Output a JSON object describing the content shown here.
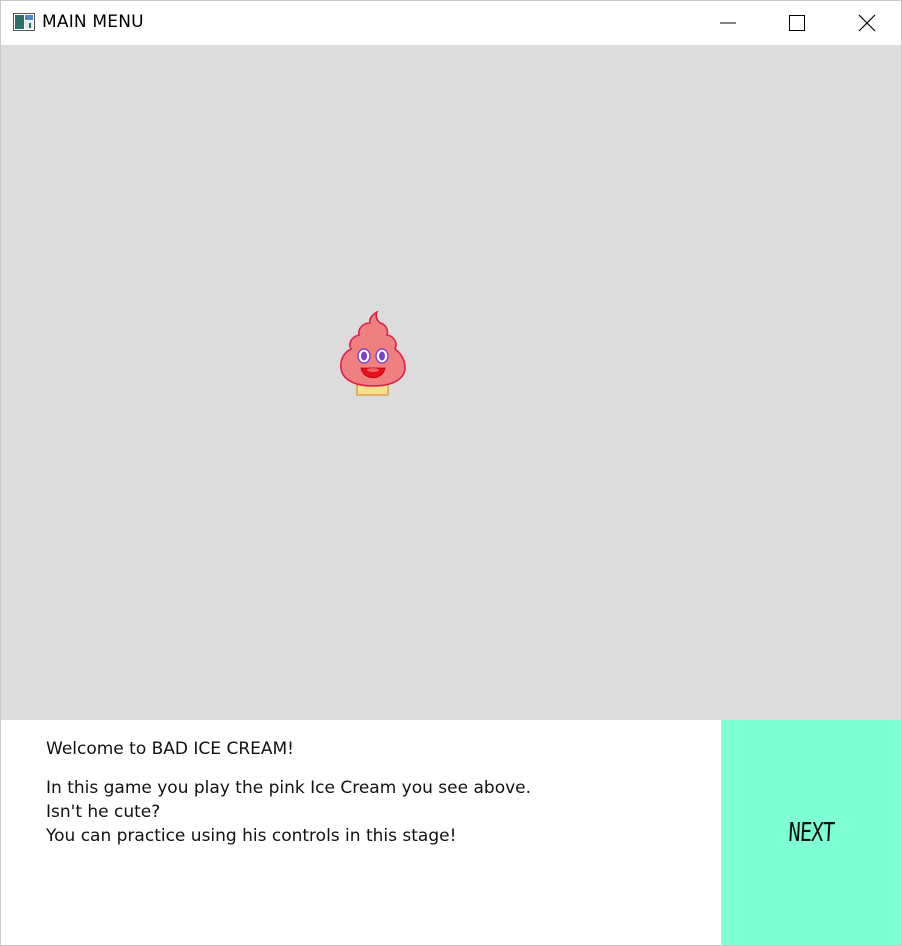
{
  "window": {
    "title": "MAIN MENU",
    "controls": {
      "minimize": "minimize-icon",
      "maximize": "maximize-icon",
      "close": "close-icon"
    }
  },
  "stage": {
    "background_color": "#dcdcdc",
    "player": {
      "character": "pink ice cream",
      "body_color": "#f08080",
      "outline_color": "#e0204a",
      "cone_color": "#f8e08c",
      "eye_color": "#7b3fd0",
      "mouth_color": "#e8101a"
    }
  },
  "dialog": {
    "welcome": "Welcome to BAD ICE CREAM!",
    "line1": "In this game you play the pink Ice Cream you see above.",
    "line2": "Isn't he cute?",
    "line3": "You can practice using his controls in this stage!"
  },
  "next_button": {
    "label": "NEXT",
    "color": "#7fffd4"
  }
}
